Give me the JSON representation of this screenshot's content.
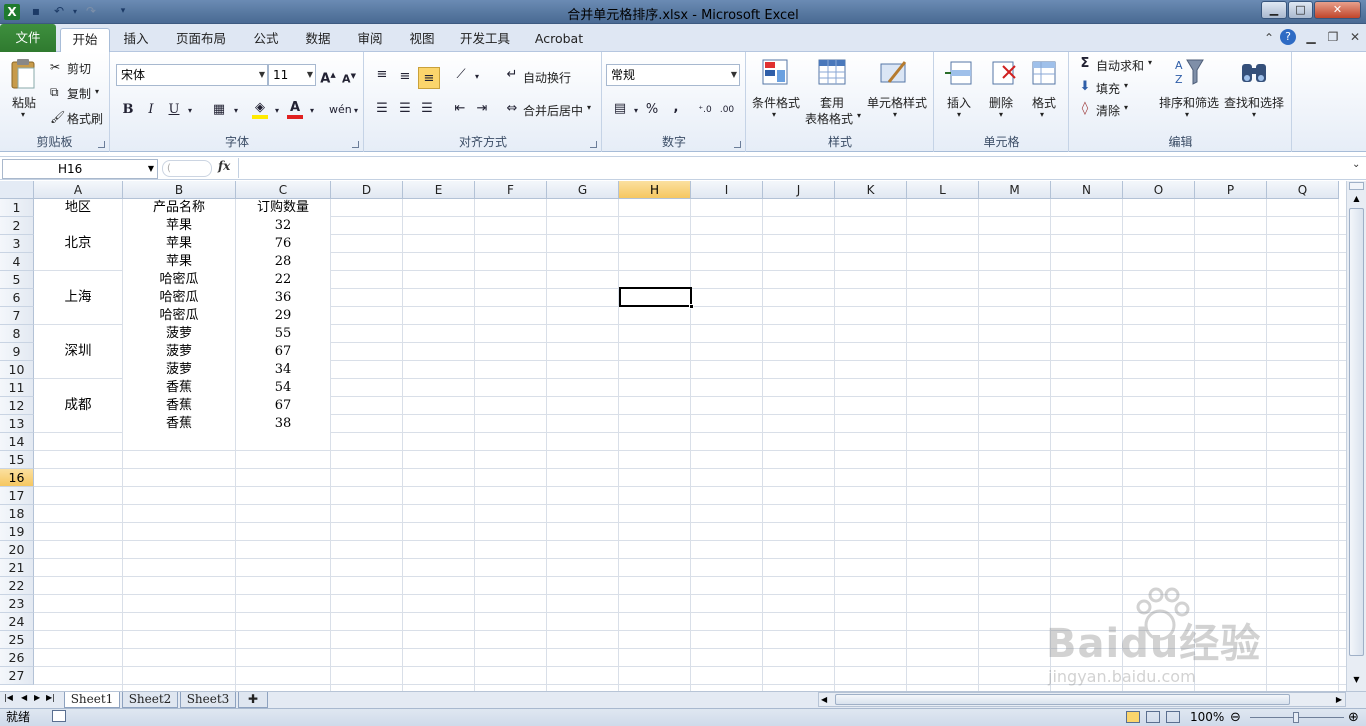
{
  "window": {
    "title": "合并单元格排序.xlsx  -  Microsoft Excel"
  },
  "tabs": [
    "文件",
    "开始",
    "插入",
    "页面布局",
    "公式",
    "数据",
    "审阅",
    "视图",
    "开发工具",
    "Acrobat"
  ],
  "ribbon": {
    "clipboard": {
      "label": "剪贴板",
      "paste": "粘贴",
      "cut": "剪切",
      "copy": "复制",
      "format_painter": "格式刷"
    },
    "font": {
      "label": "字体",
      "font_name": "宋体",
      "font_size": "11",
      "bold": "B",
      "italic": "I",
      "underline": "U",
      "font_color_letter": "A"
    },
    "alignment": {
      "label": "对齐方式",
      "wrap_text": "自动换行",
      "merge_center": "合并后居中"
    },
    "number": {
      "label": "数字",
      "format": "常规",
      "percent": "%",
      "comma": ","
    },
    "styles": {
      "label": "样式",
      "conditional": "条件格式",
      "table_format_1": "套用",
      "table_format_2": "表格格式",
      "cell_styles": "单元格样式"
    },
    "cells": {
      "label": "单元格",
      "insert": "插入",
      "delete": "删除",
      "format": "格式"
    },
    "editing": {
      "label": "编辑",
      "autosum": "自动求和",
      "fill": "填充",
      "clear": "清除",
      "sort_filter": "排序和筛选",
      "find_select": "查找和选择"
    }
  },
  "formula_bar": {
    "name_box": "H16",
    "fx": "fx",
    "formula": ""
  },
  "columns": [
    "A",
    "B",
    "C",
    "D",
    "E",
    "F",
    "G",
    "H",
    "I",
    "J",
    "K",
    "L",
    "M",
    "N",
    "O",
    "P",
    "Q"
  ],
  "rows": [
    "1",
    "2",
    "3",
    "4",
    "5",
    "6",
    "7",
    "8",
    "9",
    "10",
    "11",
    "12",
    "13",
    "14",
    "15",
    "16",
    "17",
    "18",
    "19",
    "20",
    "21",
    "22",
    "23",
    "24",
    "25",
    "26",
    "27"
  ],
  "sheet": {
    "header": {
      "a": "地区",
      "b": "产品名称",
      "c": "订购数量"
    },
    "regions": [
      "北京",
      "上海",
      "深圳",
      "成都"
    ],
    "products": [
      "苹果",
      "苹果",
      "苹果",
      "哈密瓜",
      "哈密瓜",
      "哈密瓜",
      "菠萝",
      "菠萝",
      "菠萝",
      "香蕉",
      "香蕉",
      "香蕉"
    ],
    "quantities": [
      "32",
      "76",
      "28",
      "22",
      "36",
      "29",
      "55",
      "67",
      "34",
      "54",
      "67",
      "38"
    ]
  },
  "sheet_tabs": [
    "Sheet1",
    "Sheet2",
    "Sheet3"
  ],
  "status": {
    "mode": "就绪",
    "zoom": "100%"
  },
  "watermark": {
    "text": "Baidu经验",
    "url": "jingyan.baidu.com"
  }
}
